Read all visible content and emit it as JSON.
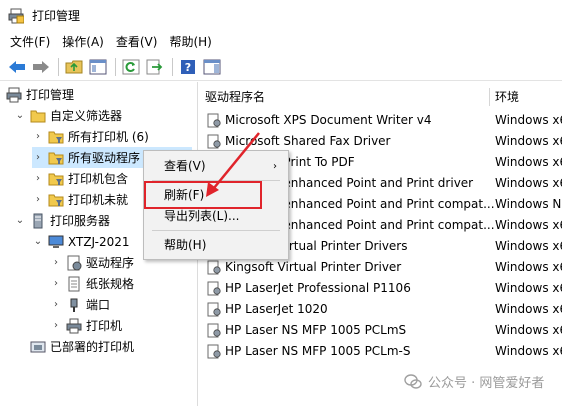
{
  "window": {
    "title": "打印管理"
  },
  "menu": [
    "文件(F)",
    "操作(A)",
    "查看(V)",
    "帮助(H)"
  ],
  "tree": {
    "root": "打印管理",
    "custom_filters": "自定义筛选器",
    "all_printers": "所有打印机 (6)",
    "all_drivers": "所有驱动程序 (12)",
    "printers_with_jobs": "打印机包含",
    "printers_not_ready": "打印机未就",
    "print_servers": "打印服务器",
    "server": "XTZJ-2021",
    "drivers": "驱动程序",
    "forms": "纸张规格",
    "ports": "端口",
    "printers": "打印机",
    "deployed": "已部署的打印机"
  },
  "columns": {
    "name": "驱动程序名",
    "env": "环境"
  },
  "rows": [
    {
      "name": "Microsoft XPS Document Writer v4",
      "env": "Windows x6"
    },
    {
      "name": "Microsoft Shared Fax Driver",
      "env": "Windows x6"
    },
    {
      "name": "Microsoft Print To PDF",
      "env": "Windows x6"
    },
    {
      "name": "Microsoft enhanced Point and Print driver",
      "env": "Windows x6"
    },
    {
      "name": "Microsoft enhanced Point and Print compat...",
      "env": "Windows N"
    },
    {
      "name": "Microsoft enhanced Point and Print compat...",
      "env": "Windows x6"
    },
    {
      "name": "Kingsoft Virtual Printer Drivers",
      "env": "Windows x6"
    },
    {
      "name": "Kingsoft Virtual Printer Driver",
      "env": "Windows x6"
    },
    {
      "name": "HP LaserJet Professional P1106",
      "env": "Windows x6"
    },
    {
      "name": "HP LaserJet 1020",
      "env": "Windows x6"
    },
    {
      "name": "HP Laser NS MFP 1005 PCLmS",
      "env": "Windows x6"
    },
    {
      "name": "HP Laser NS MFP 1005 PCLm-S",
      "env": "Windows x6"
    }
  ],
  "context_menu": {
    "view": "查看(V)",
    "refresh": "刷新(F)",
    "export": "导出列表(L)...",
    "help": "帮助(H)"
  },
  "watermark": "公众号 · 网管爱好者",
  "colors": {
    "accent": "#e0242b",
    "selection": "#cce8ff"
  }
}
